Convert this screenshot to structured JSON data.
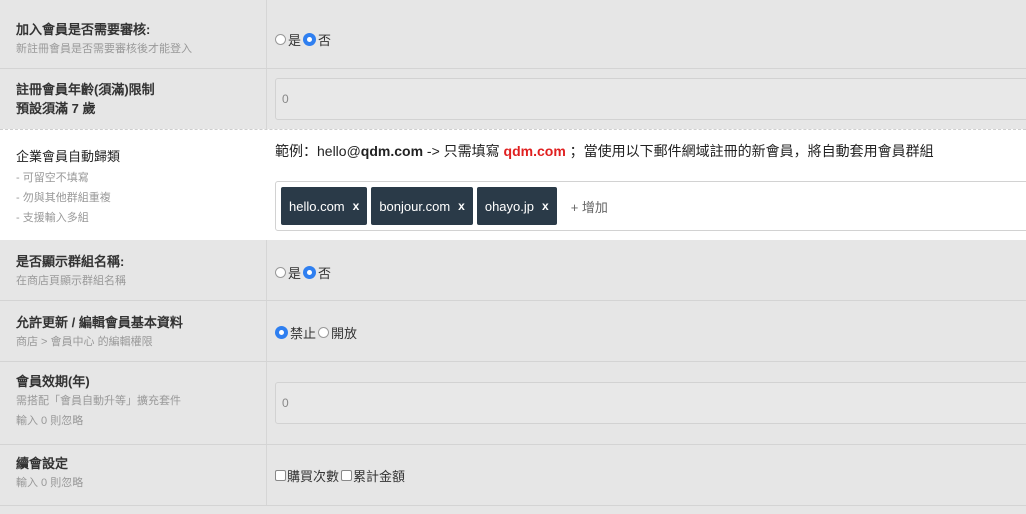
{
  "rows": {
    "review": {
      "title": "加入會員是否需要審核:",
      "sub": "新註冊會員是否需要審核後才能登入",
      "options": [
        {
          "label": "是",
          "checked": false
        },
        {
          "label": "否",
          "checked": true
        }
      ]
    },
    "age": {
      "title": "註冊會員年齡(須滿)限制",
      "title2": "預設須滿 7 歲",
      "value": "0"
    },
    "auto_group": {
      "title": "企業會員自動歸類",
      "notes": [
        "- 可留空不填寫",
        "- 勿與其他群組重複",
        "- 支援輸入多組"
      ],
      "example_prefix": "範例：hello@",
      "example_domain": "qdm.com",
      "example_mid": " -> 只需填寫 ",
      "example_red": "qdm.com",
      "example_suffix": "；當使用以下郵件網域註冊的新會員，將自動套用會員群組",
      "tags": [
        "hello.com",
        "bonjour.com",
        "ohayo.jp"
      ],
      "tag_remove": "x",
      "add_label": "+ 增加"
    },
    "show_group": {
      "title": "是否顯示群組名稱:",
      "sub": "在商店頁顯示群組名稱",
      "options": [
        {
          "label": "是",
          "checked": false
        },
        {
          "label": "否",
          "checked": true
        }
      ]
    },
    "allow_update": {
      "title": "允許更新 / 編輯會員基本資料",
      "sub": "商店 > 會員中心 的編輯權限",
      "options": [
        {
          "label": "禁止",
          "checked": true
        },
        {
          "label": "開放",
          "checked": false
        }
      ]
    },
    "validity": {
      "title": "會員效期(年)",
      "sub": "需搭配「會員自動升等」擴充套件",
      "sub2": "輸入 0 則忽略",
      "value": "0"
    },
    "renew": {
      "title": "續會設定",
      "sub": "輸入 0 則忽略",
      "checks": [
        {
          "label": "購買次數",
          "checked": false
        },
        {
          "label": "累計金額",
          "checked": false
        }
      ]
    }
  }
}
